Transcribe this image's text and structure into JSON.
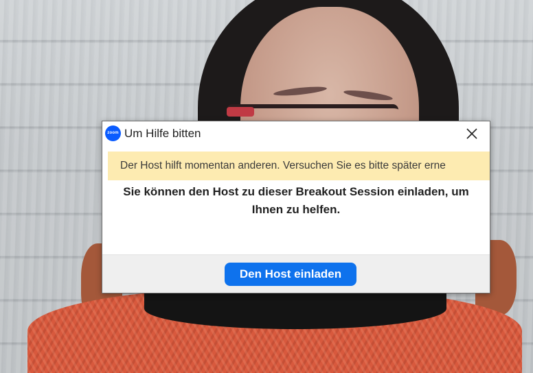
{
  "dialog": {
    "title": "Um Hilfe bitten",
    "logo_text": "zoom",
    "banner_text": "Der Host hilft momentan anderen. Versuchen Sie es bitte später erne",
    "message_line1": "Sie können den Host zu dieser Breakout Session einladen, um",
    "message_line2": "Ihnen zu helfen.",
    "invite_button": "Den Host einladen",
    "icons": {
      "app": "zoom-logo-icon",
      "close": "close-icon"
    },
    "colors": {
      "accent": "#0e72ed",
      "banner": "#fdebb1",
      "zoom_blue": "#0b5cff"
    }
  }
}
